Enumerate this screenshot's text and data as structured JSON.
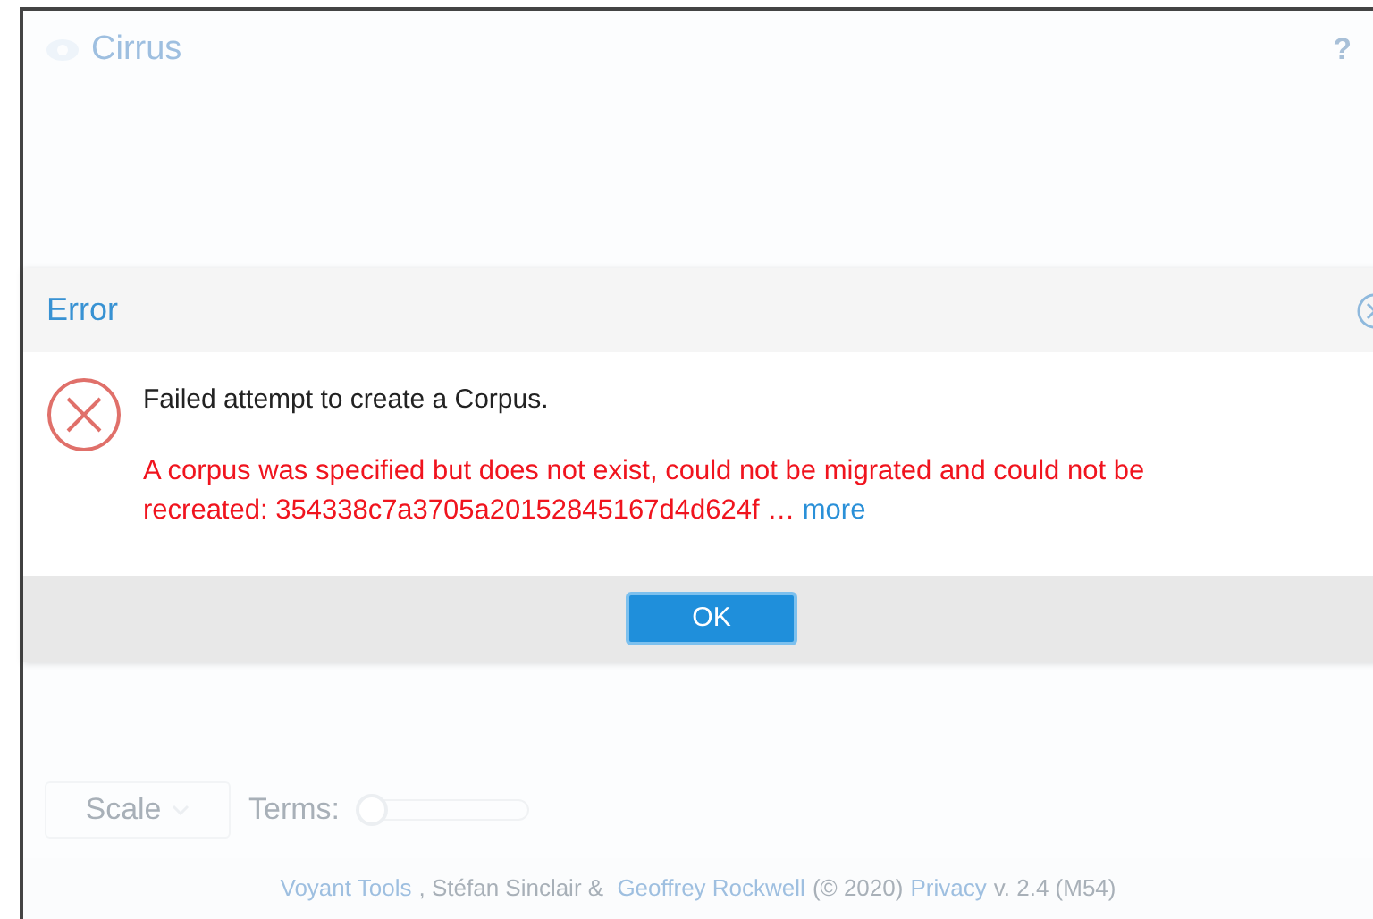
{
  "app": {
    "title": "Cirrus",
    "help": "?",
    "scale_button": "Scale",
    "terms_label": "Terms:",
    "terms_slider": {
      "level": 0.02
    },
    "footer": [
      {
        "text": "Voyant Tools",
        "link": true
      },
      {
        "text": ", Stéfan Sinclair & ",
        "link": false
      },
      {
        "text": "Geoffrey Rockwell",
        "link": true
      },
      {
        "text": "(© 2020)",
        "link": false
      },
      {
        "text": "Privacy",
        "link": true
      },
      {
        "text": "v. 2.4 (M54)",
        "link": false
      }
    ]
  },
  "dialog": {
    "title": "Error",
    "message": "Failed attempt to create a Corpus.",
    "detail": "A corpus was specified but does not exist, could not be migrated and could not be recreated: 354338c7a3705a20152845167d4d624f …",
    "more_link": "more",
    "button": "OK"
  }
}
